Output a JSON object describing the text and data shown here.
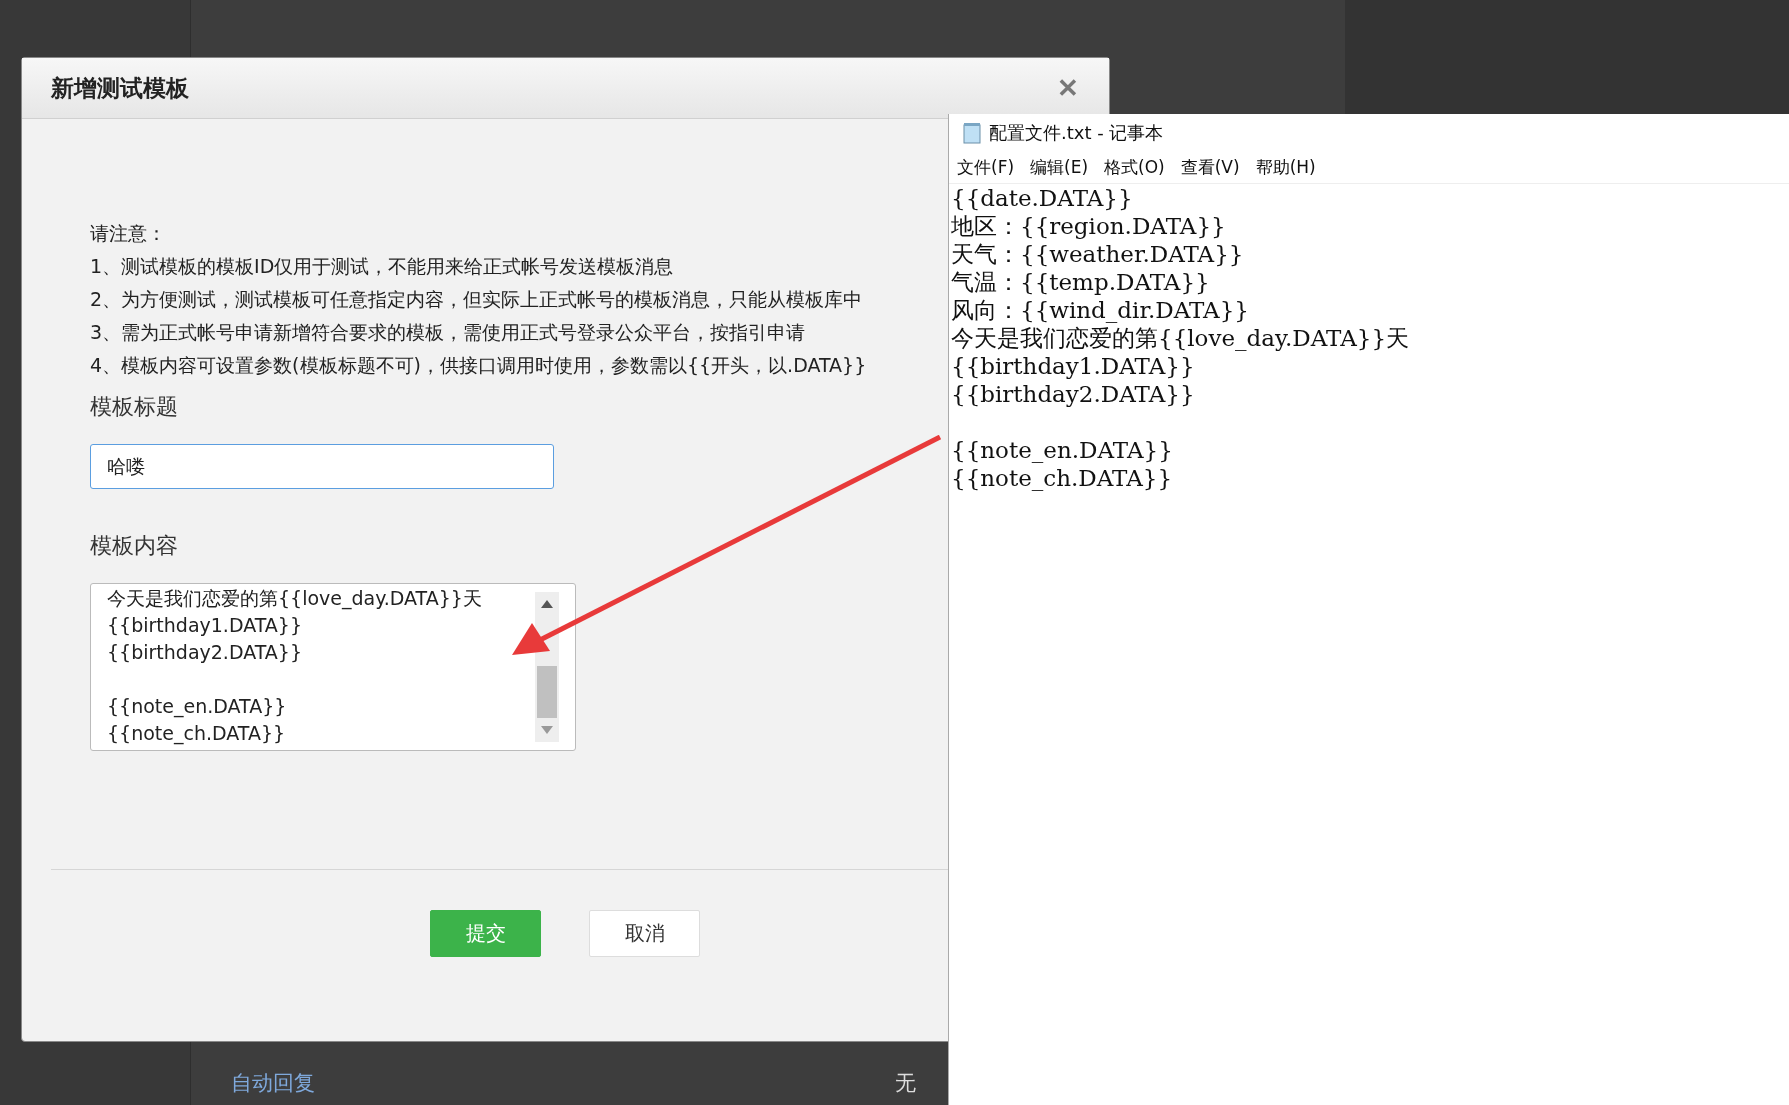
{
  "background_page": {
    "menu_link": "自动回复",
    "cell_text": "无"
  },
  "dialog": {
    "title": "新增测试模板",
    "close": "✕",
    "notice_heading": "请注意：",
    "notices": [
      "1、测试模板的模板ID仅用于测试，不能用来给正式帐号发送模板消息",
      "2、为方便测试，测试模板可任意指定内容，但实际上正式帐号的模板消息，只能从模板库中",
      "3、需为正式帐号申请新增符合要求的模板，需使用正式号登录公众平台，按指引申请",
      "4、模板内容可设置参数(模板标题不可)，供接口调用时使用，参数需以{{开头，以.DATA}}"
    ],
    "title_label": "模板标题",
    "title_value": "哈喽",
    "content_label": "模板内容",
    "content_paragraphs": [
      [
        "今天是我们恋爱的第{{love_day.DATA}}天",
        "{{birthday1.DATA}}",
        "{{birthday2.DATA}}"
      ],
      [
        "{{note_en.DATA}}",
        "{{note_ch.DATA}}"
      ]
    ],
    "buttons": [
      {
        "label": "提交",
        "kind": "primary"
      },
      {
        "label": "取消",
        "kind": "secondary"
      }
    ]
  },
  "notepad": {
    "title": "配置文件.txt - 记事本",
    "menu": [
      "文件(F)",
      "编辑(E)",
      "格式(O)",
      "查看(V)",
      "帮助(H)"
    ],
    "paragraphs": [
      [
        "{{date.DATA}}",
        "地区：{{region.DATA}}",
        "天气：{{weather.DATA}}",
        "气温：{{temp.DATA}}",
        "风向：{{wind_dir.DATA}}",
        "今天是我们恋爱的第{{love_day.DATA}}天",
        "{{birthday1.DATA}}",
        "{{birthday2.DATA}}"
      ],
      [
        "{{note_en.DATA}}",
        "{{note_ch.DATA}}"
      ]
    ]
  }
}
